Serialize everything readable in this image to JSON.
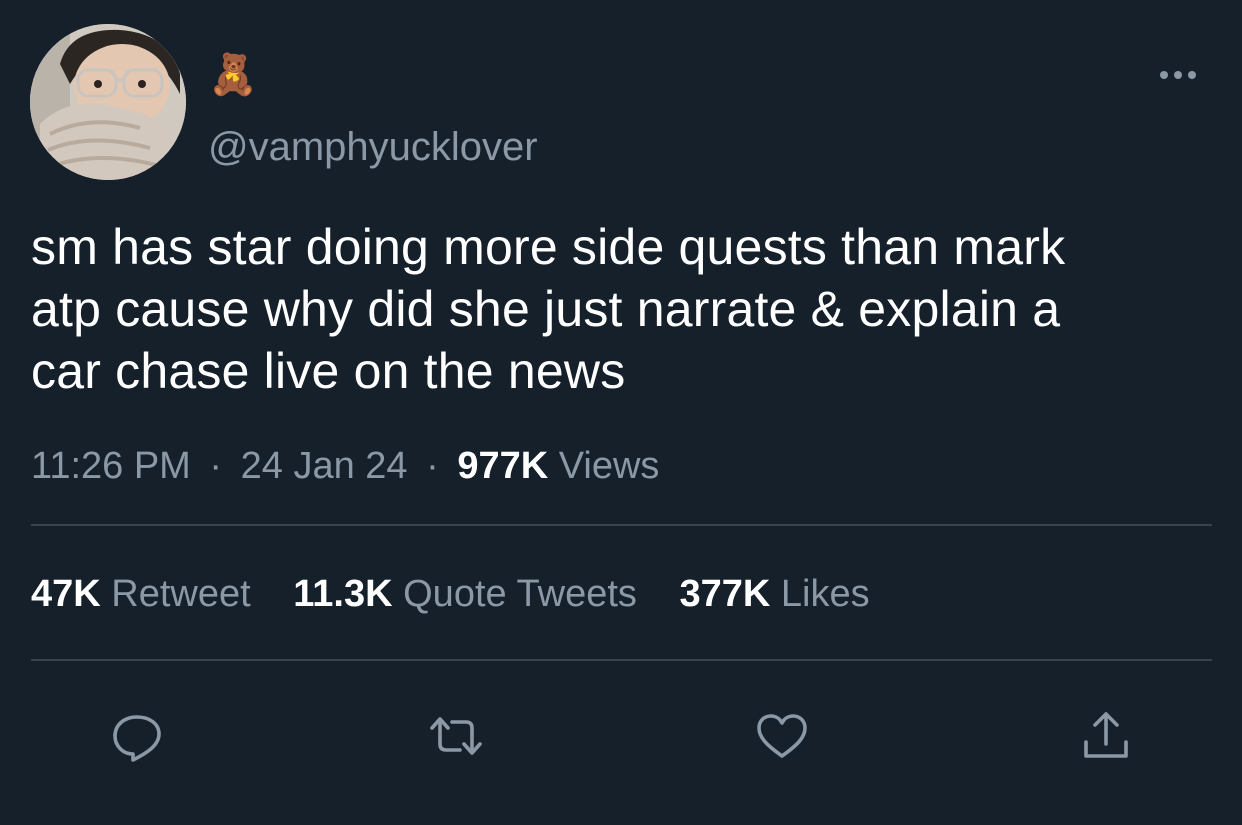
{
  "author": {
    "display_name": "🧸",
    "handle": "@vamphyucklover"
  },
  "tweet": {
    "text": "sm has star doing more side quests than mark\natp cause why did she just narrate & explain a\ncar chase live on the news",
    "time": "11:26 PM",
    "date": "24 Jan 24",
    "separator": "·",
    "views_count": "977K",
    "views_label": "Views"
  },
  "stats": {
    "retweets_count": "47K",
    "retweets_label": "Retweet",
    "quotes_count": "11.3K",
    "quotes_label": "Quote Tweets",
    "likes_count": "377K",
    "likes_label": "Likes"
  },
  "icons": {
    "more": "more-horizontal-icon",
    "reply": "reply-icon",
    "retweet": "retweet-icon",
    "like": "heart-icon",
    "share": "share-icon"
  },
  "colors": {
    "background": "#15202b",
    "secondary_text": "#8b98a5",
    "divider": "#38444d",
    "primary_text": "#ffffff"
  }
}
